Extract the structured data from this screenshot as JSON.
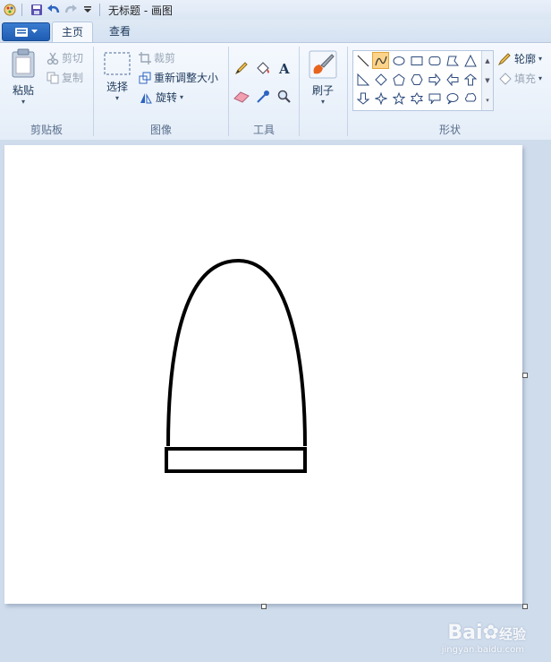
{
  "window": {
    "title": "无标题 - 画图"
  },
  "tabs": [
    {
      "label": "主页",
      "active": true
    },
    {
      "label": "查看",
      "active": false
    }
  ],
  "clipboard": {
    "group_label": "剪贴板",
    "paste": "粘贴",
    "cut": "剪切",
    "copy": "复制"
  },
  "image": {
    "group_label": "图像",
    "select": "选择",
    "crop": "裁剪",
    "resize": "重新调整大小",
    "rotate": "旋转"
  },
  "tools": {
    "group_label": "工具"
  },
  "brushes": {
    "label": "刷子"
  },
  "shapes": {
    "group_label": "形状",
    "outline": "轮廓",
    "fill": "填充",
    "selected": "curve"
  },
  "watermark": {
    "brand": "Bai",
    "brand2": "经验",
    "url": "jingyan.baidu.com"
  },
  "colors": {
    "ribbon_bg": "#f5f9fe",
    "workspace": "#cfdcec",
    "accent": "#1f5cb3",
    "selected_shape": "#fbd38a"
  }
}
